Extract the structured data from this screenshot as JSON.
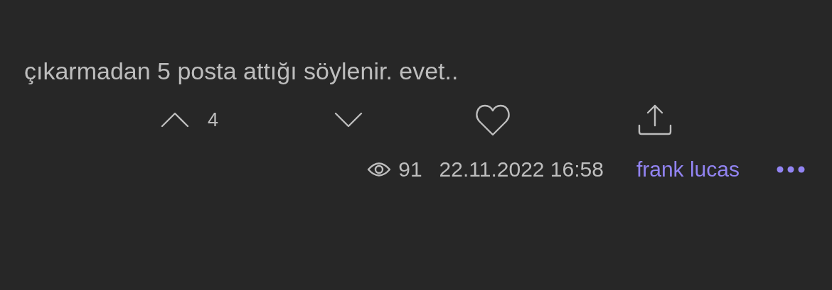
{
  "post": {
    "text": "çıkarmadan 5 posta attığı söylenir. evet..",
    "actions": {
      "upvote_count": "4"
    },
    "meta": {
      "views": "91",
      "date": "22.11.2022 16:58",
      "author": "frank lucas"
    }
  }
}
